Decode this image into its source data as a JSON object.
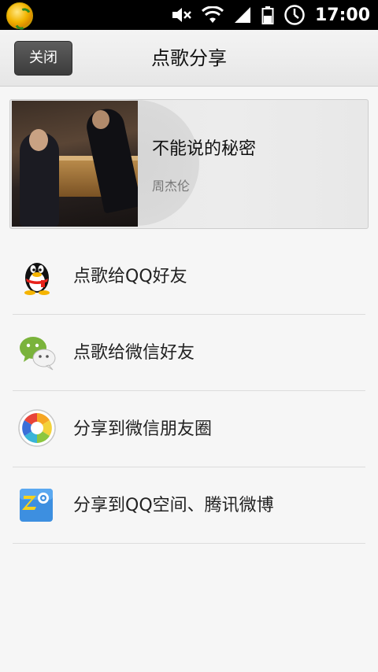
{
  "status_bar": {
    "time": "17:00",
    "icons": [
      "app-icon",
      "mute-icon",
      "wifi-icon",
      "signal-icon",
      "battery-icon",
      "alarm-icon"
    ]
  },
  "header": {
    "close_label": "关闭",
    "title": "点歌分享"
  },
  "song": {
    "title": "不能说的秘密",
    "artist": "周杰伦"
  },
  "share_options": [
    {
      "label": "点歌给QQ好友",
      "icon": "qq-penguin-icon"
    },
    {
      "label": "点歌给微信好友",
      "icon": "wechat-icon"
    },
    {
      "label": "分享到微信朋友圈",
      "icon": "moments-icon"
    },
    {
      "label": "分享到QQ空间、腾讯微博",
      "icon": "qzone-icon"
    }
  ],
  "colors": {
    "status_bar": "#000000",
    "header_bg": "#ececec",
    "close_button": "#4a4a4a",
    "page_bg": "#f6f6f6",
    "divider": "#dcdcdc"
  }
}
